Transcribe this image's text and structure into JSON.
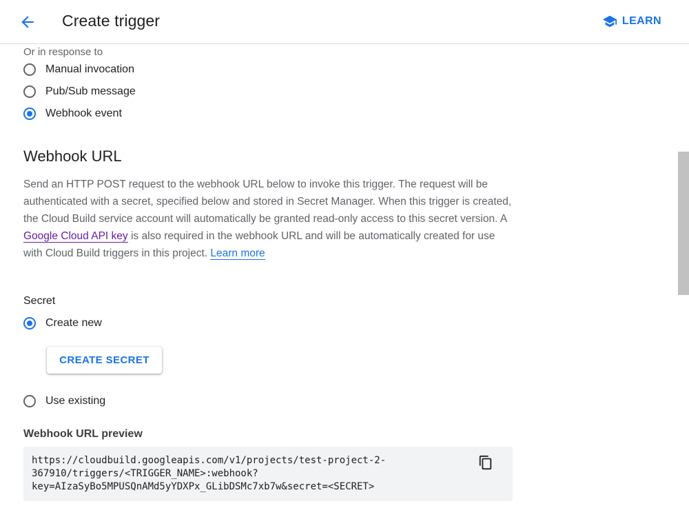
{
  "header": {
    "title": "Create trigger",
    "learn_label": "LEARN"
  },
  "response": {
    "label": "Or in response to",
    "options": [
      {
        "label": "Manual invocation",
        "checked": false
      },
      {
        "label": "Pub/Sub message",
        "checked": false
      },
      {
        "label": "Webhook event",
        "checked": true
      }
    ]
  },
  "webhook": {
    "heading": "Webhook URL",
    "description": {
      "part1": "Send an HTTP POST request to the webhook URL below to invoke this trigger. The request will be authenticated with a secret, specified below and stored in Secret Manager. When this trigger is created, the Cloud Build service account will automatically be granted read-only access to this secret version. A ",
      "api_key_link": "Google Cloud API key",
      "part2": " is also required in the webhook URL and will be automatically created for use with Cloud Build triggers in this project. ",
      "learn_more_link": "Learn more"
    }
  },
  "secret": {
    "label": "Secret",
    "create_new_label": "Create new",
    "create_new_checked": true,
    "create_secret_button": "CREATE SECRET",
    "use_existing_label": "Use existing",
    "use_existing_checked": false
  },
  "preview": {
    "label": "Webhook URL preview",
    "url": "https://cloudbuild.googleapis.com/v1/projects/test-project-2-\n367910/triggers/<TRIGGER_NAME>:webhook?\nkey=AIzaSyBo5MPUSQnAMd5yYDXPx_GLibDSMc7xb7w&secret=<SECRET>"
  },
  "colors": {
    "accent": "#1a73e8",
    "visited_link": "#681da8",
    "preview_bg": "#f1f3f4"
  },
  "icons": {
    "back": "arrow-back-icon",
    "learn": "school-icon",
    "copy": "copy-icon"
  }
}
